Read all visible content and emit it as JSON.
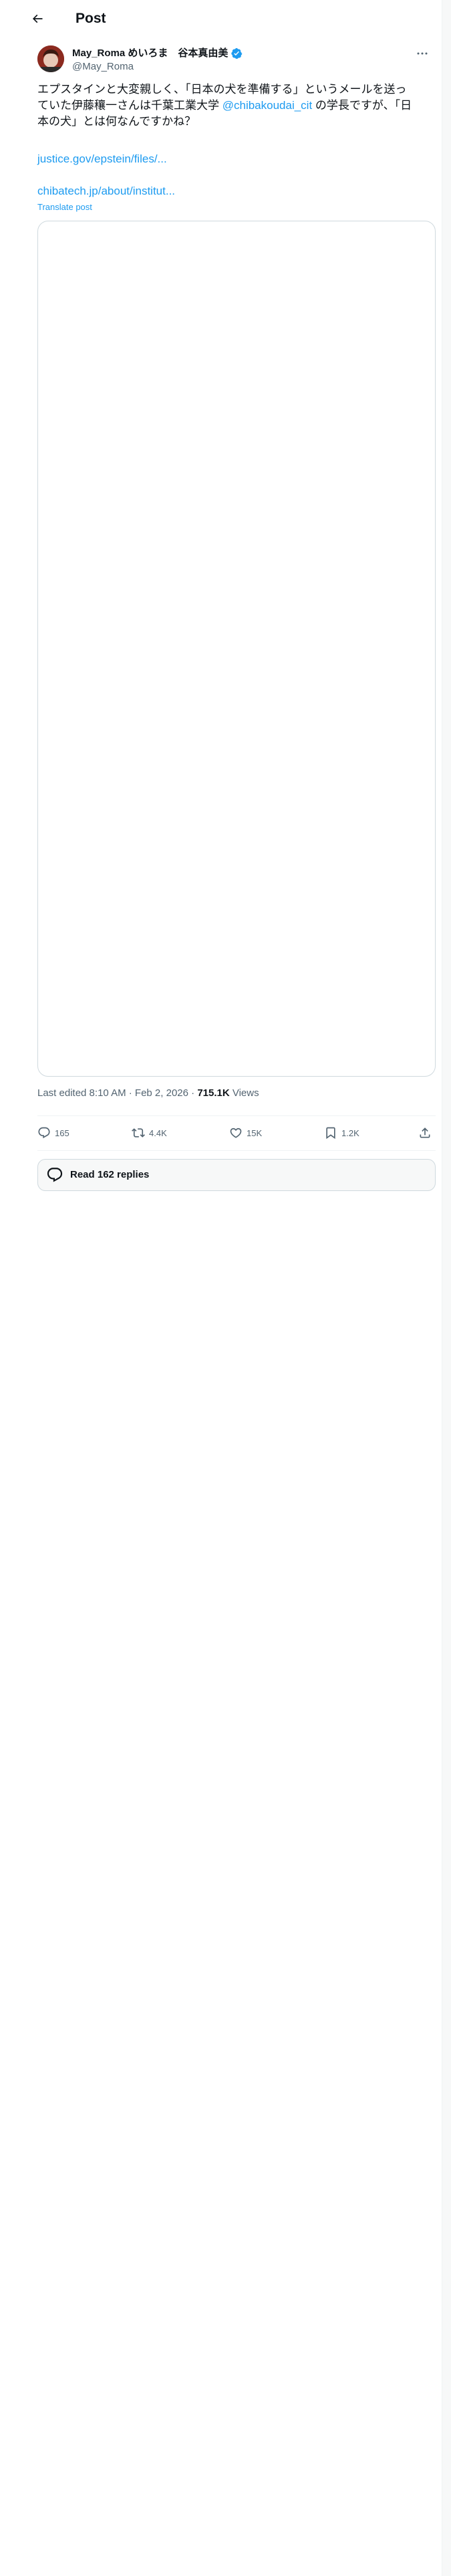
{
  "header": {
    "title": "Post"
  },
  "author": {
    "name": "May_Roma めいろま　谷本真由美",
    "handle": "@May_Roma"
  },
  "post": {
    "text_line1": "エプスタインと大変親しく、「日本の犬を準備する」というメールを送っ",
    "text_line2_before": "ていた伊藤穰一さんは千葉工業大学 ",
    "mention": "@chibakoudai_cit",
    "text_line2_after": " の学長ですが、「日",
    "text_line3": "本の犬」とは何なんですかね？",
    "link1": "justice.gov/epstein/files/...",
    "link2": "chibatech.jp/about/institut...",
    "translate": "Translate post"
  },
  "meta": {
    "edited": "Last edited 8:10 AM · Feb 2, 2026 · ",
    "views_count": "715.1K",
    "views_label": " Views"
  },
  "actions": {
    "replies": "165",
    "reposts": "4.4K",
    "likes": "15K",
    "bookmarks": "1.2K"
  },
  "read_replies": "Read 162 replies",
  "colors": {
    "accent": "#1d9bf0",
    "secondary_text": "#536471",
    "border": "#cfd9de"
  }
}
